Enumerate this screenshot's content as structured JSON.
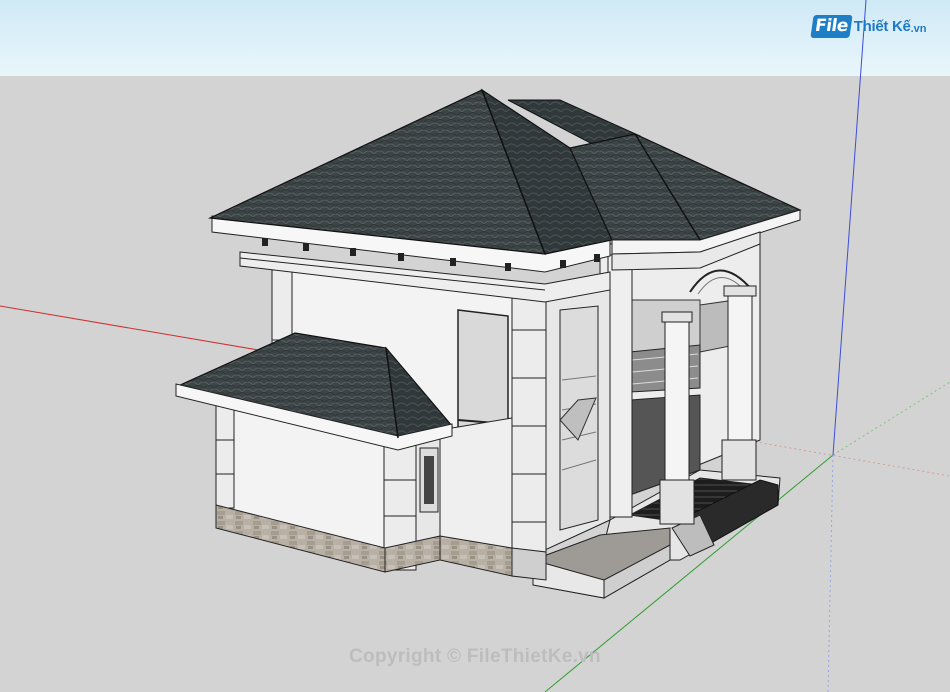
{
  "logo": {
    "badge": "File",
    "brand": "Thiết Kế",
    "tld": ".vn"
  },
  "watermark": "Copyright © FileThietKe.vn",
  "colors": {
    "sky_top": "#cfe9f6",
    "ground": "#d3d3d3",
    "roof": "#3f4749",
    "wall": "#f3f3f3",
    "stone_base": "#b7afa4",
    "axis_red": "#d03030",
    "axis_green": "#2e9e2e",
    "axis_blue": "#3b4fd6",
    "brand_blue": "#1e7fc6"
  },
  "icons": [
    "red-axis-icon",
    "green-axis-icon",
    "blue-axis-icon"
  ]
}
